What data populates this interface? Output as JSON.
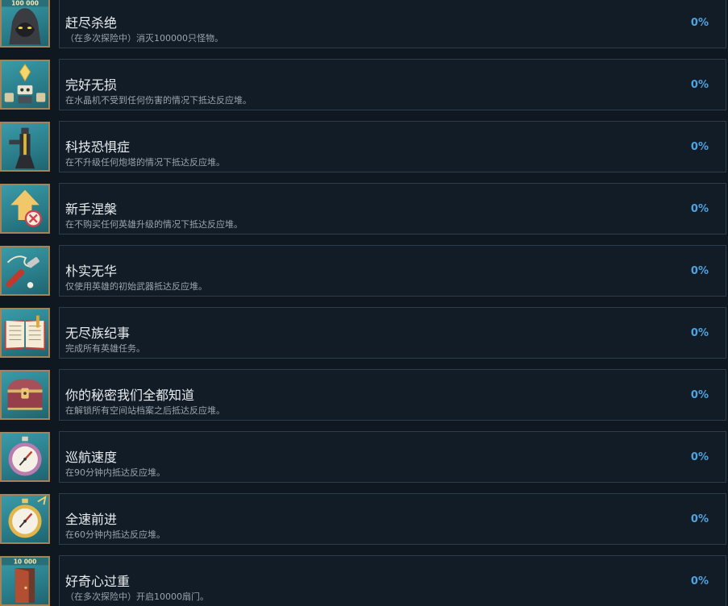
{
  "achievements": [
    {
      "title": "赶尽杀绝",
      "desc": "（在多次探险中）消灭100000只怪物。",
      "progress": "0%",
      "icon": "hooded-figure-icon",
      "counter": "100 000"
    },
    {
      "title": "完好无损",
      "desc": "在水晶机不受到任何伤害的情况下抵达反应堆。",
      "progress": "0%",
      "icon": "crystal-robot-icon"
    },
    {
      "title": "科技恐惧症",
      "desc": "在不升级任何炮塔的情况下抵达反应堆。",
      "progress": "0%",
      "icon": "turret-icon"
    },
    {
      "title": "新手涅槃",
      "desc": "在不购买任何英雄升级的情况下抵达反应堆。",
      "progress": "0%",
      "icon": "no-upgrade-arrow-icon"
    },
    {
      "title": "朴实无华",
      "desc": "仅使用英雄的初始武器抵达反应堆。",
      "progress": "0%",
      "icon": "wrench-weapon-icon"
    },
    {
      "title": "无尽族纪事",
      "desc": "完成所有英雄任务。",
      "progress": "0%",
      "icon": "open-book-icon"
    },
    {
      "title": "你的秘密我们全都知道",
      "desc": "在解锁所有空间站档案之后抵达反应堆。",
      "progress": "0%",
      "icon": "treasure-chest-icon"
    },
    {
      "title": "巡航速度",
      "desc": "在90分钟内抵达反应堆。",
      "progress": "0%",
      "icon": "stopwatch-icon"
    },
    {
      "title": "全速前进",
      "desc": "在60分钟内抵达反应堆。",
      "progress": "0%",
      "icon": "gold-stopwatch-icon"
    },
    {
      "title": "好奇心过重",
      "desc": "（在多次探险中）开启10000扇门。",
      "progress": "0%",
      "icon": "door-icon",
      "counter": "10 000"
    }
  ]
}
